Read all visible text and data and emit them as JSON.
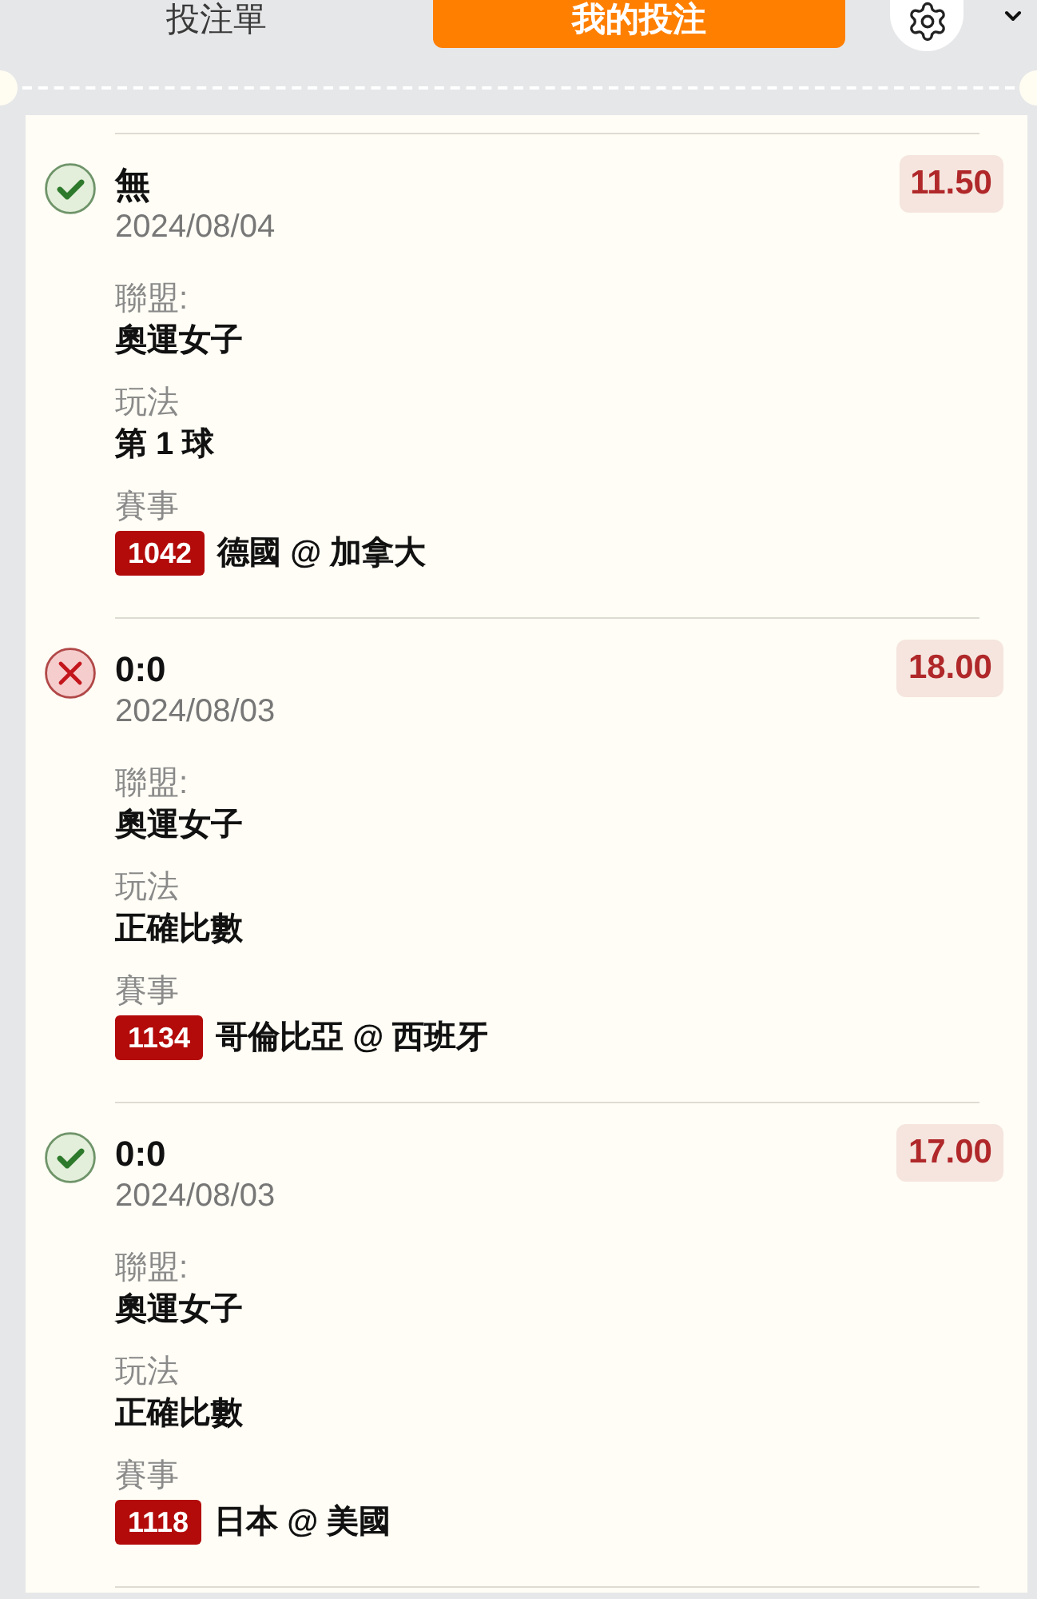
{
  "header": {
    "tabs": [
      {
        "label": "投注單",
        "selected": false
      },
      {
        "label": "我的投注",
        "selected": true
      }
    ]
  },
  "bets": [
    {
      "won": true,
      "selection": "無",
      "date": "2024/08/04",
      "odds": "11.50",
      "fields": [
        {
          "label": "聯盟:",
          "value": "奧運女子"
        },
        {
          "label": "玩法",
          "value": "第 1 球"
        }
      ],
      "event": {
        "label": "賽事",
        "number": "1042",
        "match": "德國 @ 加拿大"
      }
    },
    {
      "won": false,
      "selection": "0:0",
      "date": "2024/08/03",
      "odds": "18.00",
      "fields": [
        {
          "label": "聯盟:",
          "value": "奧運女子"
        },
        {
          "label": "玩法",
          "value": "正確比數"
        }
      ],
      "event": {
        "label": "賽事",
        "number": "1134",
        "match": "哥倫比亞 @ 西班牙"
      }
    },
    {
      "won": true,
      "selection": "0:0",
      "date": "2024/08/03",
      "odds": "17.00",
      "fields": [
        {
          "label": "聯盟:",
          "value": "奧運女子"
        },
        {
          "label": "玩法",
          "value": "正確比數"
        }
      ],
      "event": {
        "label": "賽事",
        "number": "1118",
        "match": "日本 @ 美國"
      }
    }
  ]
}
